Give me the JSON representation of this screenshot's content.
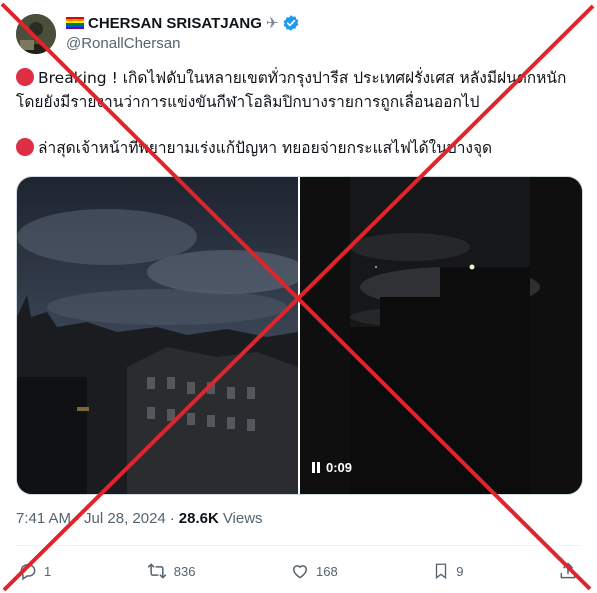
{
  "author": {
    "display_name": "CHERSAN SRISATJANG",
    "handle": "@RonallChersan",
    "flag_icon": "rainbow-flag-icon",
    "emoji_icon": "airplane-icon",
    "verified_icon": "verified-badge-icon",
    "verified_color": "#1d9bf0"
  },
  "tweet": {
    "paragraph1": "Breaking ! เกิดไฟดับในหลายเขตทั่วกรุงปารีส ประเทศฝรั่งเศส หลังมีฝนตกหนัก โดยยังมีรายงานว่าการแข่งขันกีฬาโอลิมปิกบางรายการถูกเลื่อนออกไป",
    "paragraph2": "ล่าสุดเจ้าหน้าที่พยายามเร่งแก้ปัญหา ทยอยจ่ายกระแสไฟได้ในบางจุด",
    "bullet_color": "#dd2e44"
  },
  "media": {
    "video_duration": "0:09"
  },
  "meta": {
    "time": "7:41 AM",
    "separator": "·",
    "date": "Jul 28, 2024",
    "views_count": "28.6K",
    "views_label": "Views"
  },
  "actions": {
    "replies": "1",
    "reposts": "836",
    "likes": "168",
    "bookmarks": "9"
  },
  "overlay": {
    "color": "#e0242b",
    "meaning": "false-claim-cross"
  }
}
